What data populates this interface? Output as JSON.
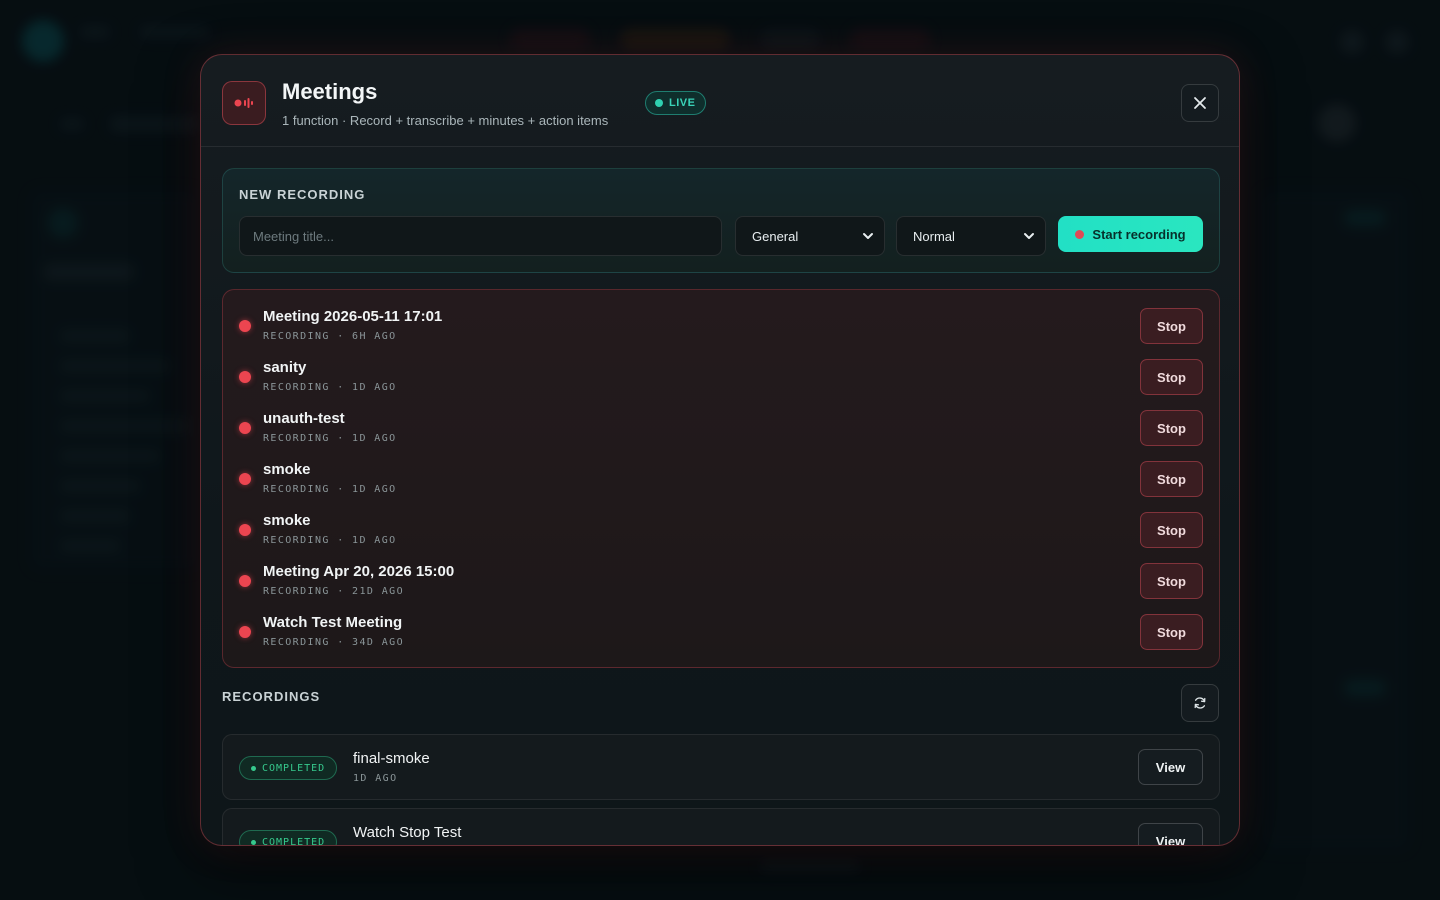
{
  "modal": {
    "title": "Meetings",
    "subtitle": "1 function · Record + transcribe + minutes + action items",
    "live_label": "LIVE",
    "close_icon": "close-icon",
    "accent": "#22e0c5",
    "danger": "#ec4550"
  },
  "new_recording": {
    "label": "NEW RECORDING",
    "title_placeholder": "Meeting title...",
    "title_value": "",
    "category_selected": "General",
    "priority_selected": "Normal",
    "start_label": "Start recording"
  },
  "active_recordings": [
    {
      "title": "Meeting 2026-05-11 17:01",
      "meta": "RECORDING · 6H AGO",
      "action": "Stop"
    },
    {
      "title": "sanity",
      "meta": "RECORDING · 1D AGO",
      "action": "Stop"
    },
    {
      "title": "unauth-test",
      "meta": "RECORDING · 1D AGO",
      "action": "Stop"
    },
    {
      "title": "smoke",
      "meta": "RECORDING · 1D AGO",
      "action": "Stop"
    },
    {
      "title": "smoke",
      "meta": "RECORDING · 1D AGO",
      "action": "Stop"
    },
    {
      "title": "Meeting Apr 20, 2026 15:00",
      "meta": "RECORDING · 21D AGO",
      "action": "Stop"
    },
    {
      "title": "Watch Test Meeting",
      "meta": "RECORDING · 34D AGO",
      "action": "Stop"
    }
  ],
  "recordings": {
    "label": "RECORDINGS",
    "refresh_icon": "refresh-icon",
    "items": [
      {
        "status": "COMPLETED",
        "title": "final-smoke",
        "meta": "1D AGO",
        "action": "View"
      },
      {
        "status": "COMPLETED",
        "title": "Watch Stop Test",
        "meta": "",
        "action": "View"
      }
    ]
  }
}
